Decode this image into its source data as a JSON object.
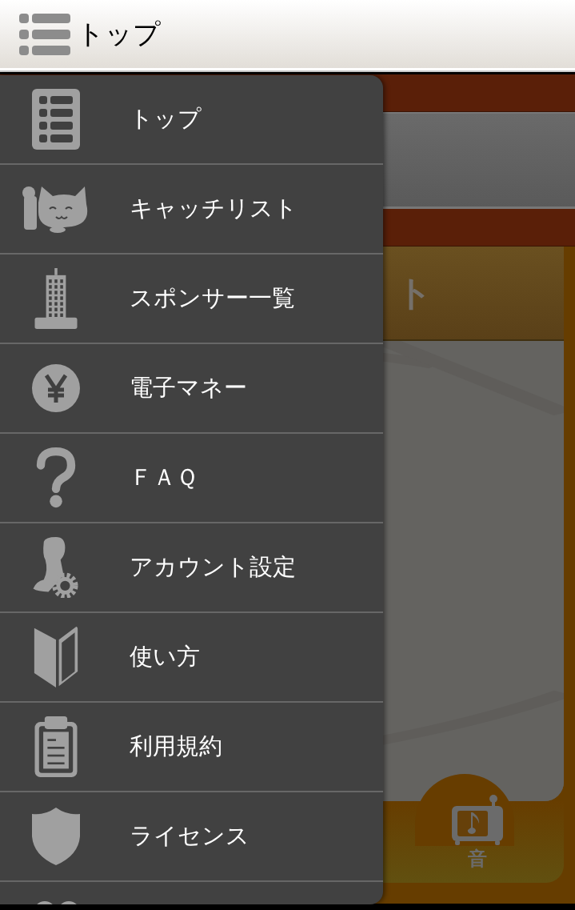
{
  "header": {
    "title": "トップ"
  },
  "background": {
    "section_title": "ト",
    "tab_label": "音"
  },
  "menu": [
    {
      "kind": "list",
      "label": "トップ"
    },
    {
      "kind": "cat",
      "label": "キャッチリスト"
    },
    {
      "kind": "building",
      "label": "スポンサー一覧"
    },
    {
      "kind": "yen",
      "label": "電子マネー"
    },
    {
      "kind": "question",
      "label": "ＦＡＱ"
    },
    {
      "kind": "user",
      "label": "アカウント設定"
    },
    {
      "kind": "beginner",
      "label": "使い方"
    },
    {
      "kind": "clipboard",
      "label": "利用規約"
    },
    {
      "kind": "shield",
      "label": "ライセンス"
    },
    {
      "kind": "circles"
    }
  ]
}
